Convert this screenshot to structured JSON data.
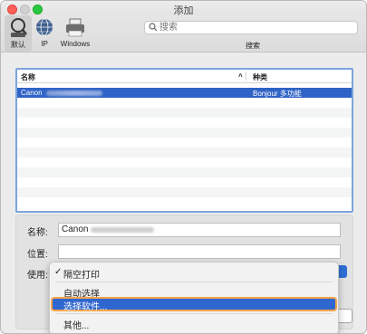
{
  "window": {
    "title": "添加"
  },
  "toolbar": {
    "items": [
      {
        "label": "默认"
      },
      {
        "label": "IP"
      },
      {
        "label": "Windows"
      }
    ],
    "search_placeholder": "搜索",
    "search_label": "搜索"
  },
  "list": {
    "col_name": "名称",
    "col_kind": "种类",
    "sort_indicator": "^",
    "rows": [
      {
        "name": "Canon",
        "kind": "Bonjour 多功能"
      }
    ]
  },
  "form": {
    "name_label": "名称:",
    "name_value": "Canon",
    "location_label": "位置:",
    "location_value": "",
    "use_label": "使用:"
  },
  "use_menu": {
    "selected_mark": "✓",
    "items": [
      {
        "label": "隔空打印"
      },
      {
        "label": "自动选择"
      },
      {
        "label": "选择软件..."
      },
      {
        "label": "其他..."
      }
    ]
  },
  "colors": {
    "selection": "#2f63c6",
    "highlight_ring": "#f5a44a"
  }
}
